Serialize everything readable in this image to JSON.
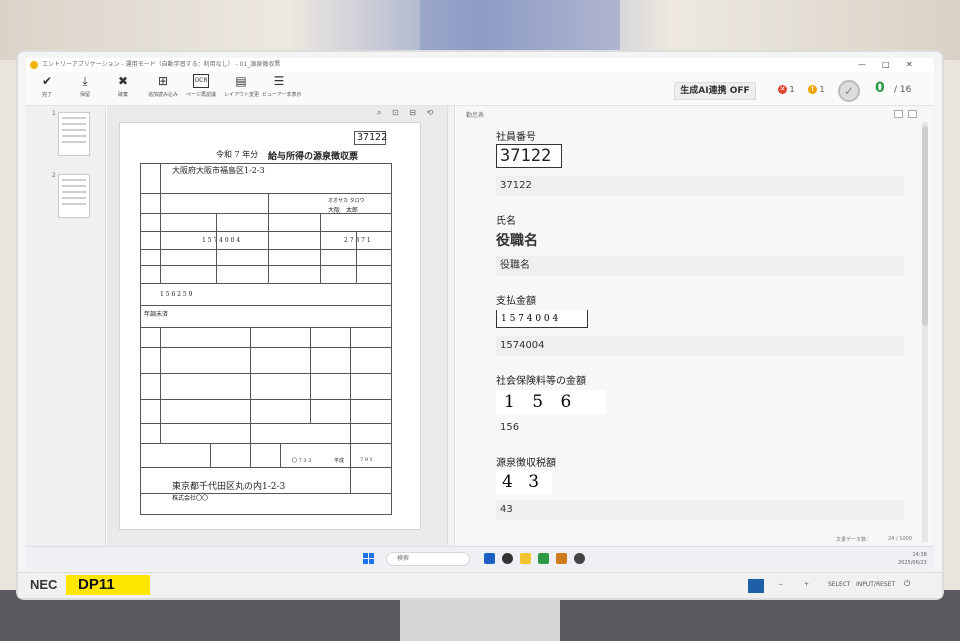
{
  "window": {
    "title": "エントリーアプリケーション - 運用モード（自動学習する：利用なし） - 01_源泉徴収票",
    "minimize": "—",
    "maximize": "□",
    "close": "✕"
  },
  "toolbar": {
    "buttons": [
      {
        "label": "完了",
        "icon": "check-tray-icon"
      },
      {
        "label": "保留",
        "icon": "tray-down-icon"
      },
      {
        "label": "破棄",
        "icon": "tray-x-icon"
      },
      {
        "label": "追加読み込み",
        "icon": "add-doc-icon"
      },
      {
        "label": "ページ再認識",
        "icon": "ocr-icon"
      },
      {
        "label": "レイアウト変更",
        "icon": "layout-icon"
      },
      {
        "label": "ビューアー非表示",
        "icon": "viewer-icon"
      }
    ],
    "ai_toggle": "生成AI連携 OFF",
    "errors": "1",
    "warnings": "1",
    "done_count": "0",
    "total": "/ 16"
  },
  "thumbnails": {
    "pages": [
      "1",
      "2"
    ]
  },
  "document": {
    "stamp_number": "37122",
    "header": "令和 7 年分",
    "title": "給与所得の源泉徴収票",
    "address1": "大阪府大阪市福島区1-2-3",
    "person_reading": "オオサカ タロウ",
    "person_name": "大阪　太郎",
    "payment": "1 5 7 4 0 0 4",
    "deduction_digits": "2 7 8 7 1",
    "insurance": "1 5 6   2 5 9",
    "note": "年調未済",
    "footer_address": "東京都千代田区丸の内1-2-3",
    "footer_company": "株式会社〇〇",
    "era": "平成",
    "birth_digits": "7 9 1",
    "birth_month": "〇 7 3 3"
  },
  "form": {
    "header": "勤怠表",
    "fields": [
      {
        "label": "社員番号",
        "image_text": "37122",
        "value": "37122"
      },
      {
        "label": "氏名",
        "image_text": "役職名",
        "value": "役職名"
      },
      {
        "label": "支払金額",
        "image_text": "1 5 7 4 0 0 4",
        "value": "1574004"
      },
      {
        "label": "社会保険料等の金額",
        "image_text": "1 5 6",
        "value": "156"
      },
      {
        "label": "源泉徴収税額",
        "image_text": "4 3",
        "value": "43"
      }
    ],
    "footer_left": "文書データ数：",
    "footer_right": "24 / 1000"
  },
  "taskbar": {
    "search_placeholder": "検索",
    "time": "14:38",
    "date": "2025/06/23"
  },
  "monitor": {
    "brand": "NEC",
    "label": "DP11",
    "buttons": [
      "−",
      "+",
      "SELECT",
      "INPUT/RESET",
      "⏻"
    ]
  },
  "colors": {
    "accent_green": "#2e9a46",
    "error_red": "#e0442e",
    "warning_orange": "#f2a100",
    "label_yellow": "#ffe600"
  }
}
